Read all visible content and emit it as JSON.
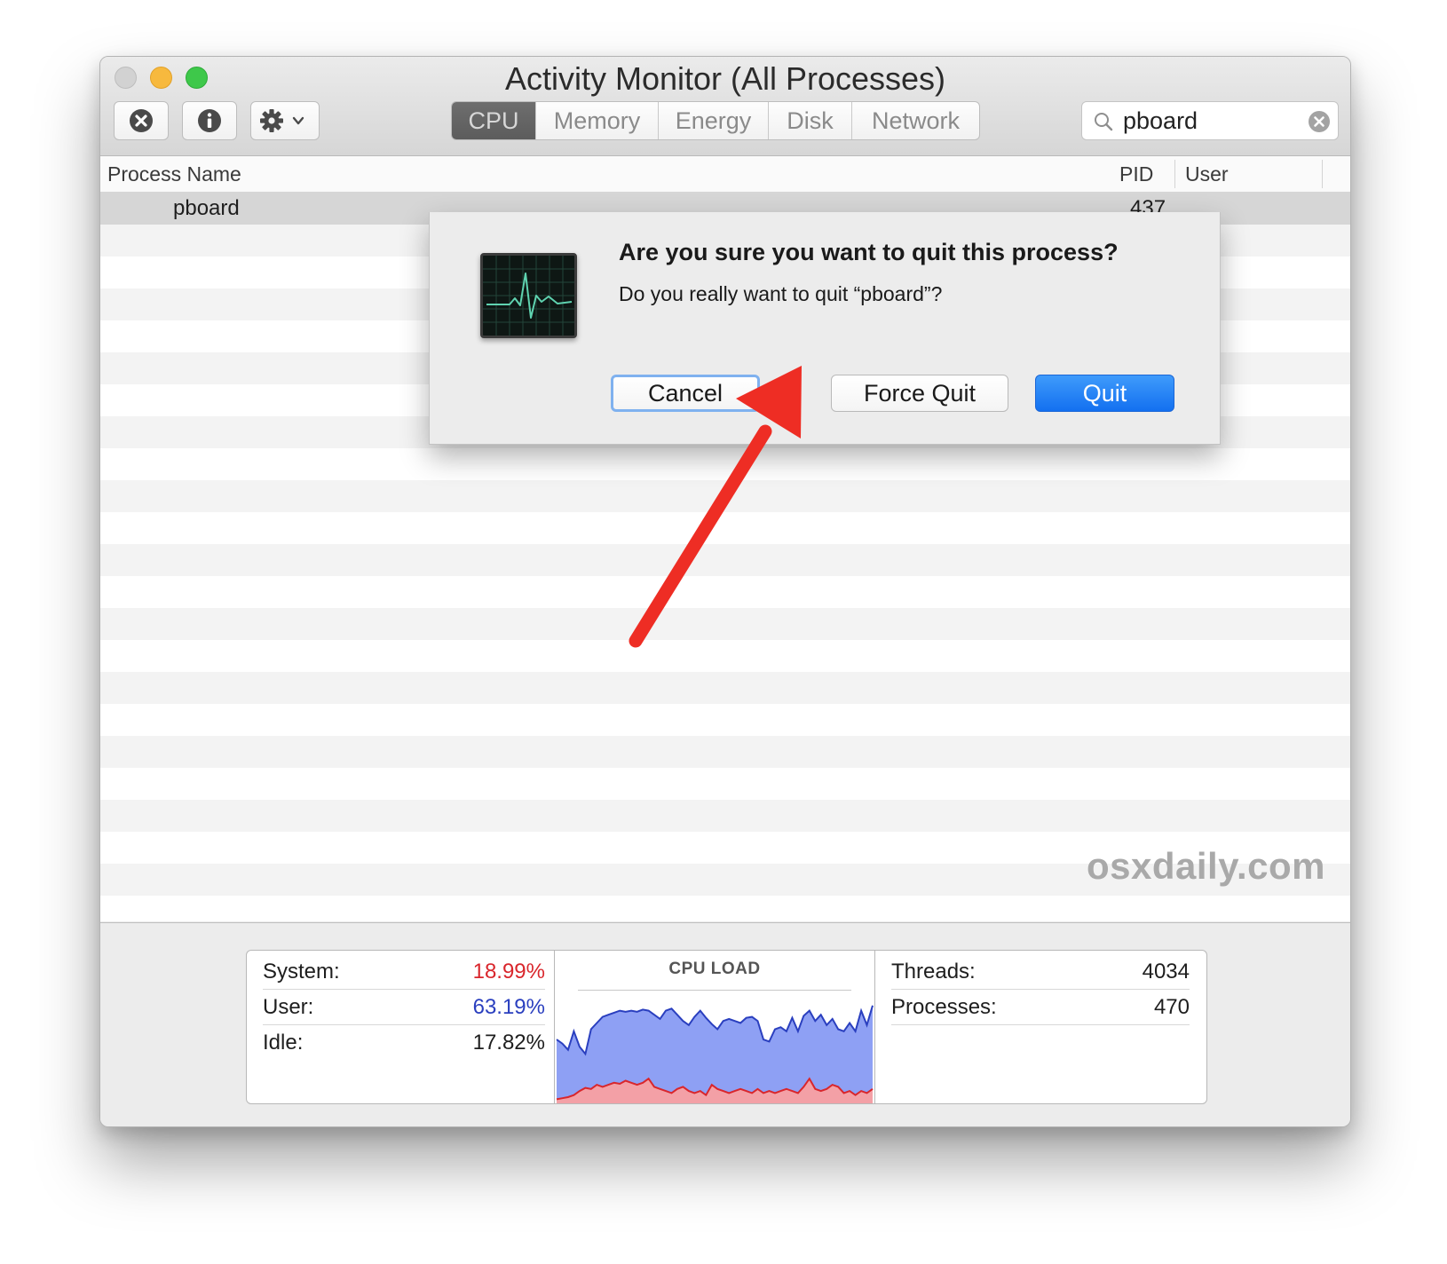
{
  "window": {
    "title": "Activity Monitor (All Processes)"
  },
  "toolbar": {
    "stop_icon": "stop-process-icon",
    "info_icon": "info-icon",
    "gear_icon": "gear-icon",
    "tabs": [
      "CPU",
      "Memory",
      "Energy",
      "Disk",
      "Network"
    ],
    "active_tab": "CPU",
    "search": {
      "value": "pboard"
    }
  },
  "table": {
    "columns": {
      "process_name": "Process Name",
      "pid": "PID",
      "user": "User"
    },
    "rows": [
      {
        "process_name": "pboard",
        "pid": "437",
        "user": ""
      }
    ]
  },
  "alert": {
    "title": "Are you sure you want to quit this process?",
    "message": "Do you really want to quit “pboard”?",
    "buttons": {
      "cancel": "Cancel",
      "force_quit": "Force Quit",
      "quit": "Quit"
    }
  },
  "watermark": "osxdaily.com",
  "stats": {
    "system_label": "System:",
    "system_value": "18.99%",
    "user_label": "User:",
    "user_value": "63.19%",
    "idle_label": "Idle:",
    "idle_value": "17.82%",
    "cpu_load_title": "CPU LOAD",
    "threads_label": "Threads:",
    "threads_value": "4034",
    "processes_label": "Processes:",
    "processes_value": "470"
  },
  "colors": {
    "system": "#d9262c",
    "user": "#2a3fbf",
    "accent": "#1a73f0",
    "annotation_arrow": "#ee2d24"
  },
  "cpu_load_graph": {
    "total_percent": [
      62,
      58,
      52,
      70,
      55,
      48,
      72,
      78,
      84,
      86,
      88,
      90,
      89,
      90,
      89,
      91,
      90,
      86,
      82,
      90,
      92,
      86,
      80,
      76,
      84,
      90,
      83,
      77,
      72,
      80,
      82,
      80,
      78,
      83,
      84,
      80,
      62,
      60,
      72,
      74,
      70,
      83,
      70,
      85,
      90,
      80,
      86,
      76,
      82,
      72,
      70,
      78,
      70,
      90,
      76,
      95
    ],
    "system_percent": [
      4,
      5,
      6,
      8,
      12,
      15,
      14,
      18,
      16,
      18,
      20,
      19,
      22,
      20,
      18,
      20,
      24,
      16,
      14,
      12,
      10,
      14,
      16,
      12,
      10,
      12,
      8,
      18,
      14,
      12,
      10,
      12,
      14,
      12,
      10,
      14,
      10,
      12,
      10,
      12,
      14,
      12,
      10,
      16,
      24,
      14,
      12,
      14,
      18,
      16,
      10,
      12,
      8,
      12,
      10,
      14
    ]
  },
  "annotation": {
    "arrow_icon": "red-arrow-icon"
  }
}
